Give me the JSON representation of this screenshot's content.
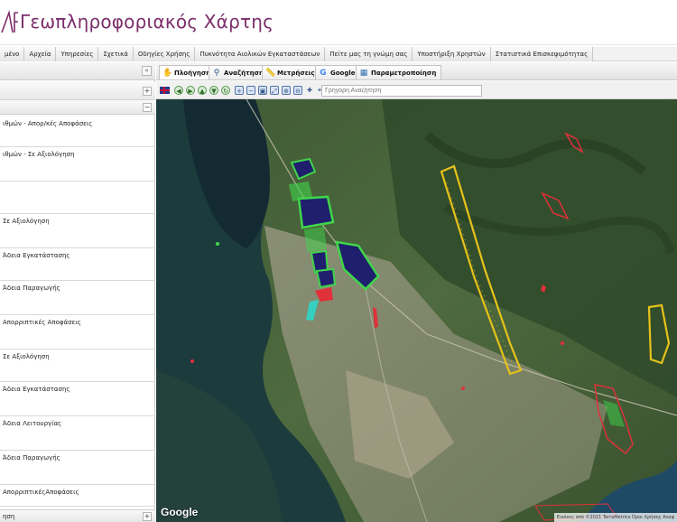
{
  "app": {
    "title": "Γεωπληροφοριακός Χάρτης"
  },
  "menu": {
    "items": [
      "μένο",
      "Αρχεία",
      "Υπηρεσίες",
      "Σχετικά",
      "Οδηγίες Χρήσης",
      "Πυκνότητα Αιολικών Εγκαταστάσεων",
      "Πείτε μας τη γνώμη σας",
      "Υποστήριξη Χρηστών",
      "Στατιστικά Επισκεψιμότητας"
    ]
  },
  "left_panel": {
    "collapse_glyph": "«",
    "expand_glyph": "+",
    "minus_glyph": "−",
    "layers": [
      "ιθμών - Απορ/κές Αποφάσεις",
      "ιθμών - Σε Αξιολόγηση",
      "",
      "Σε Αξιολόγηση",
      "Άδεια Εγκατάστασης",
      "Άδεια Παραγωγής",
      "Απορριπτικές Αποφάσεις",
      "Σε Αξιολόγηση",
      "Άδεια Εγκατάστασης",
      "Άδεια Λειτουργίας",
      "Άδεια Παραγωγής",
      "ΑπορριπτικέςΑποφάσεις"
    ],
    "bottom_label": "ηση"
  },
  "tabs": [
    {
      "label": "Πλοήγηση",
      "icon": "hand-icon",
      "glyph": "✋"
    },
    {
      "label": "Αναζήτηση",
      "icon": "search-icon",
      "glyph": "⚲"
    },
    {
      "label": "Μετρήσεις",
      "icon": "ruler-icon",
      "glyph": "📏"
    },
    {
      "label": "Google",
      "icon": "google-icon",
      "glyph": "G"
    },
    {
      "label": "Παραμετροποίηση",
      "icon": "settings-icon",
      "glyph": "▦"
    }
  ],
  "toolbar": {
    "quick_search_placeholder": "Γρήγορη Αναζήτηση"
  },
  "map": {
    "provider_label": "Google",
    "attribution": "Εικόνες από ©2021 TerraMetrics   Όροι Χρήσης   Αναφ"
  },
  "colors": {
    "title": "#7b2d6b",
    "wind_farm_yellow": "#e6c21a",
    "parcel_green": "#3fd64a",
    "parcel_navy": "#1f1f6e",
    "red_zone": "#e0303a",
    "cyan_zone": "#35d0c0"
  }
}
